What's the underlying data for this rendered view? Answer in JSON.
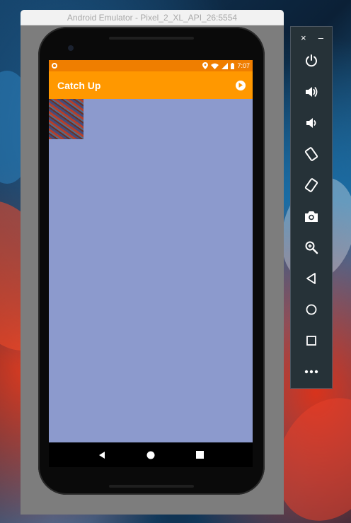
{
  "window": {
    "title": "Android Emulator - Pixel_2_XL_API_26:5554"
  },
  "status_bar": {
    "time": "7:07"
  },
  "app": {
    "title": "Catch Up"
  },
  "toolbar": {
    "close_label": "×",
    "minimize_label": "–",
    "items": [
      "power-icon",
      "volume-up-icon",
      "volume-down-icon",
      "rotate-left-icon",
      "rotate-right-icon",
      "camera-icon",
      "zoom-icon",
      "back-icon",
      "home-icon",
      "overview-icon",
      "more-icon"
    ]
  },
  "colors": {
    "status_bar": "#ef7e00",
    "app_bar": "#ff9800",
    "content_bg": "#8c9acd",
    "toolbar_bg": "#263238"
  }
}
